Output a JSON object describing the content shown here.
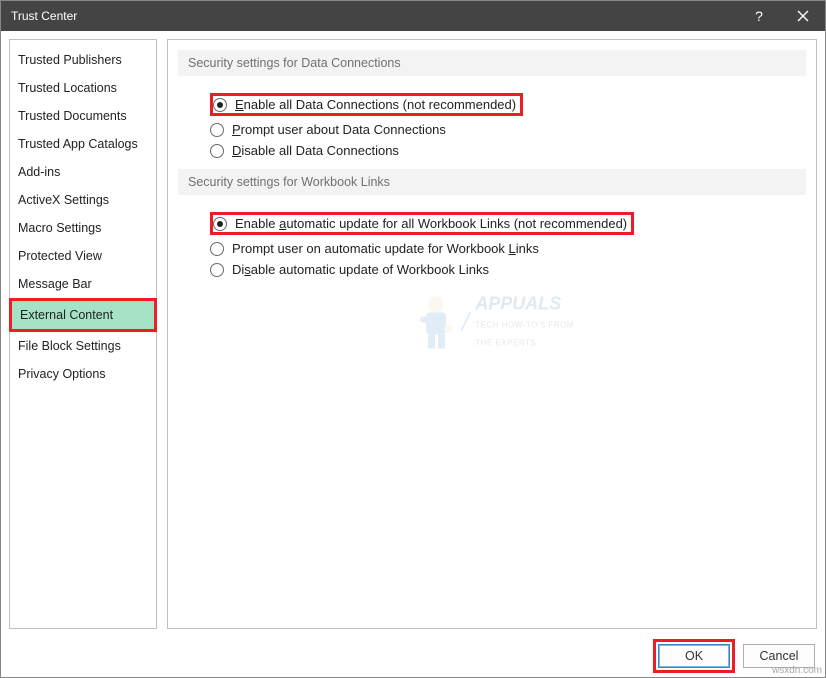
{
  "window": {
    "title": "Trust Center"
  },
  "sidebar": {
    "items": [
      {
        "label": "Trusted Publishers"
      },
      {
        "label": "Trusted Locations"
      },
      {
        "label": "Trusted Documents"
      },
      {
        "label": "Trusted App Catalogs"
      },
      {
        "label": "Add-ins"
      },
      {
        "label": "ActiveX Settings"
      },
      {
        "label": "Macro Settings"
      },
      {
        "label": "Protected View"
      },
      {
        "label": "Message Bar"
      },
      {
        "label": "External Content",
        "selected": true
      },
      {
        "label": "File Block Settings"
      },
      {
        "label": "Privacy Options"
      }
    ]
  },
  "sections": {
    "data_connections": {
      "heading": "Security settings for Data Connections",
      "options": [
        {
          "pre": "",
          "u": "E",
          "post": "nable all Data Connections (not recommended)",
          "checked": true,
          "highlighted": true
        },
        {
          "pre": "",
          "u": "P",
          "post": "rompt user about Data Connections",
          "checked": false,
          "highlighted": false
        },
        {
          "pre": "",
          "u": "D",
          "post": "isable all Data Connections",
          "checked": false,
          "highlighted": false
        }
      ]
    },
    "workbook_links": {
      "heading": "Security settings for Workbook Links",
      "options": [
        {
          "pre": "Enable ",
          "u": "a",
          "post": "utomatic update for all Workbook Links (not recommended)",
          "checked": true,
          "highlighted": true
        },
        {
          "pre": "Prompt user on automatic update for Workbook ",
          "u": "L",
          "post": "inks",
          "checked": false,
          "highlighted": false
        },
        {
          "pre": "Di",
          "u": "s",
          "post": "able automatic update of Workbook Links",
          "checked": false,
          "highlighted": false
        }
      ]
    }
  },
  "footer": {
    "ok": "OK",
    "cancel": "Cancel"
  },
  "watermark": {
    "brand": "APPUALS",
    "sub1": "TECH HOW-TO'S FROM",
    "sub2": "THE EXPERTS"
  },
  "sourcemark": "wsxdn.com"
}
